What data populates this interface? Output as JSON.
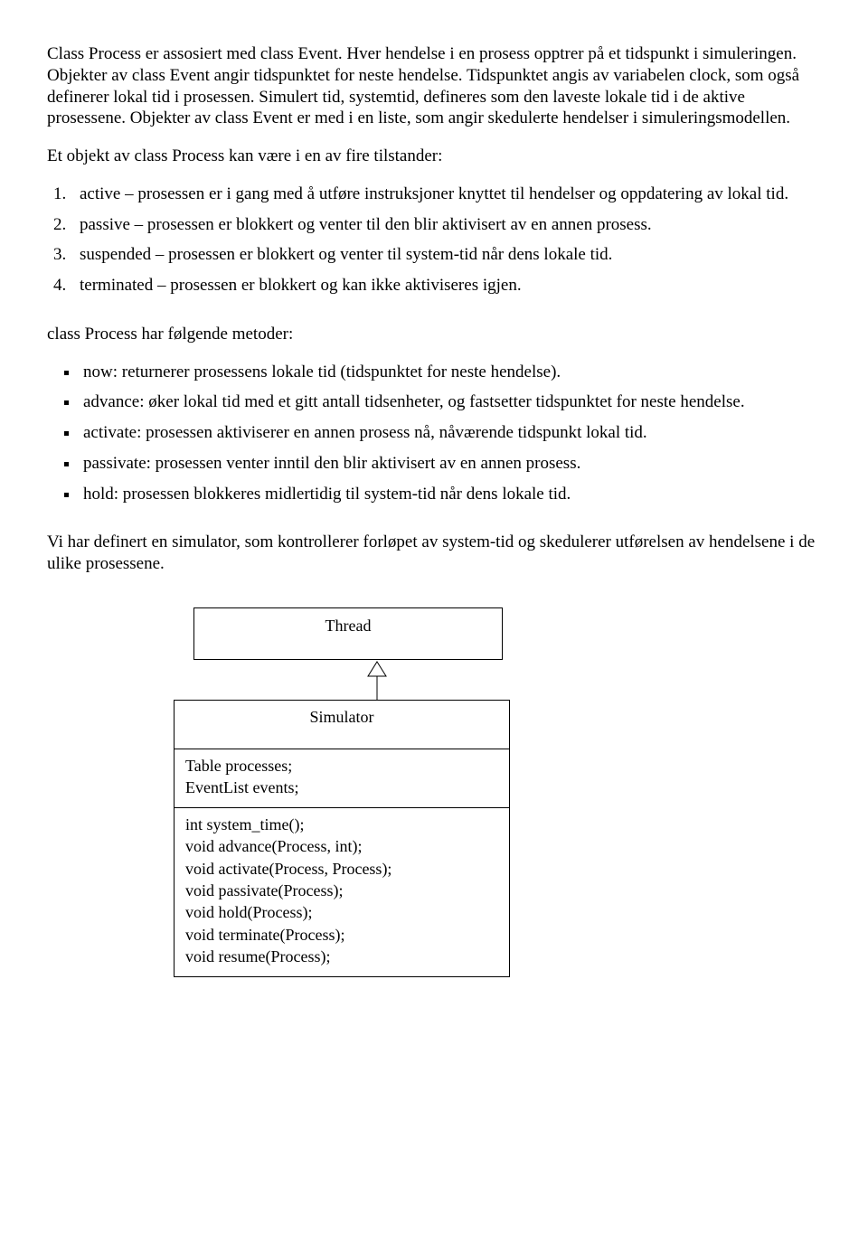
{
  "paragraphs": {
    "intro": "Class Process er assosiert med class Event. Hver hendelse i en prosess opptrer på et tidspunkt i simuleringen. Objekter av class Event angir tidspunktet for neste hendelse. Tidspunktet angis av variabelen clock, som også definerer lokal tid i prosessen. Simulert tid, systemtid, defineres som den laveste lokale tid i de aktive prosessene. Objekter av class  Event er med i en liste, som angir skedulerte hendelser i simuleringsmodellen.",
    "states_intro": "Et objekt av class Process kan være i en av fire tilstander:",
    "methods_intro": "class Process har følgende metoder:",
    "simulator_intro": "Vi har definert en simulator, som kontrollerer forløpet av system-tid og skedulerer utførelsen av hendelsene i de ulike prosessene."
  },
  "states": [
    "active – prosessen er i gang med å utføre instruksjoner knyttet til hendelser og oppdatering av lokal tid.",
    "passive – prosessen er blokkert og venter til den blir aktivisert av en annen prosess.",
    "suspended – prosessen er blokkert og venter til system-tid når dens lokale tid.",
    "terminated – prosessen er blokkert og kan ikke aktiviseres igjen."
  ],
  "methods": [
    "now: returnerer prosessens lokale tid (tidspunktet for neste hendelse).",
    "advance: øker lokal tid med et gitt antall tidsenheter, og fastsetter tidspunktet for neste hendelse.",
    "activate: prosessen aktiviserer en annen prosess nå,  nåværende tidspunkt lokal tid.",
    "passivate: prosessen venter inntil den blir aktivisert av en annen prosess.",
    "hold: prosessen blokkeres midlertidig til system-tid når dens lokale tid."
  ],
  "diagram": {
    "parent": "Thread",
    "class_name": "Simulator",
    "attributes": [
      "Table processes;",
      "EventList events;"
    ],
    "operations": [
      "int system_time();",
      "void advance(Process, int);",
      "void activate(Process, Process);",
      "void passivate(Process);",
      "void hold(Process);",
      "void terminate(Process);",
      "void resume(Process);"
    ]
  }
}
